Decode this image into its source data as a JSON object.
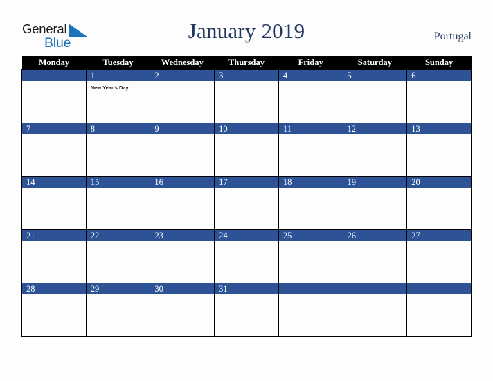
{
  "brand": {
    "name_line1": "General",
    "name_line2": "Blue",
    "triangle_icon": "triangle-icon",
    "accent_blue": "#1b74ba"
  },
  "header": {
    "title": "January 2019",
    "region": "Portugal",
    "title_color": "#23395e"
  },
  "calendar": {
    "month": "January",
    "year": "2019",
    "week_start": "Monday",
    "header_bg": "#000000",
    "daynum_bg": "#2d5396",
    "grid_color": "#000000",
    "weekdays": [
      "Monday",
      "Tuesday",
      "Wednesday",
      "Thursday",
      "Friday",
      "Saturday",
      "Sunday"
    ],
    "weeks": [
      [
        {
          "day": "",
          "event": ""
        },
        {
          "day": "1",
          "event": "New Year's Day"
        },
        {
          "day": "2",
          "event": ""
        },
        {
          "day": "3",
          "event": ""
        },
        {
          "day": "4",
          "event": ""
        },
        {
          "day": "5",
          "event": ""
        },
        {
          "day": "6",
          "event": ""
        }
      ],
      [
        {
          "day": "7",
          "event": ""
        },
        {
          "day": "8",
          "event": ""
        },
        {
          "day": "9",
          "event": ""
        },
        {
          "day": "10",
          "event": ""
        },
        {
          "day": "11",
          "event": ""
        },
        {
          "day": "12",
          "event": ""
        },
        {
          "day": "13",
          "event": ""
        }
      ],
      [
        {
          "day": "14",
          "event": ""
        },
        {
          "day": "15",
          "event": ""
        },
        {
          "day": "16",
          "event": ""
        },
        {
          "day": "17",
          "event": ""
        },
        {
          "day": "18",
          "event": ""
        },
        {
          "day": "19",
          "event": ""
        },
        {
          "day": "20",
          "event": ""
        }
      ],
      [
        {
          "day": "21",
          "event": ""
        },
        {
          "day": "22",
          "event": ""
        },
        {
          "day": "23",
          "event": ""
        },
        {
          "day": "24",
          "event": ""
        },
        {
          "day": "25",
          "event": ""
        },
        {
          "day": "26",
          "event": ""
        },
        {
          "day": "27",
          "event": ""
        }
      ],
      [
        {
          "day": "28",
          "event": ""
        },
        {
          "day": "29",
          "event": ""
        },
        {
          "day": "30",
          "event": ""
        },
        {
          "day": "31",
          "event": ""
        },
        {
          "day": "",
          "event": ""
        },
        {
          "day": "",
          "event": ""
        },
        {
          "day": "",
          "event": ""
        }
      ]
    ]
  }
}
